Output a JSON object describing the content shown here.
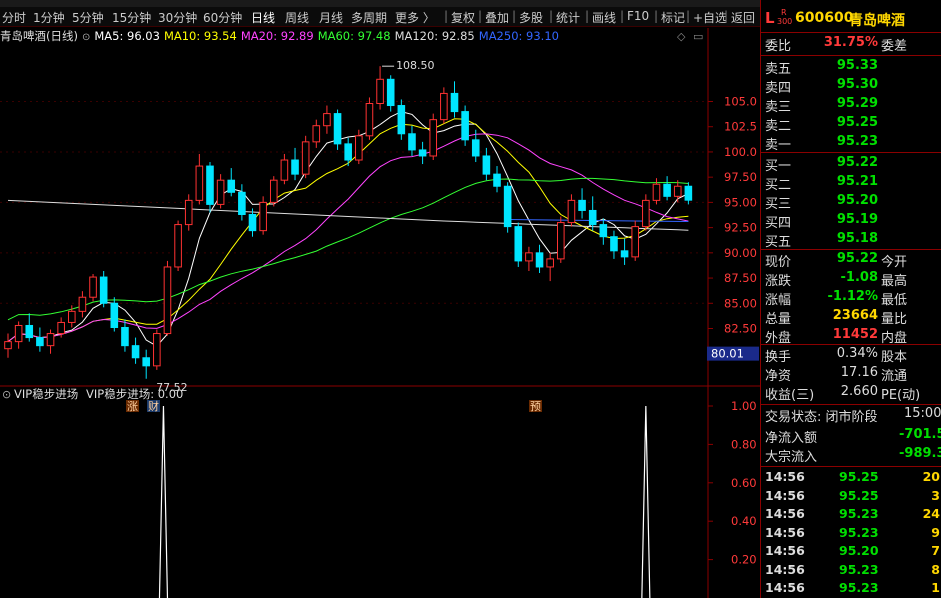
{
  "toolbar": {
    "periods": [
      "分时",
      "1分钟",
      "5分钟",
      "15分钟",
      "30分钟",
      "60分钟",
      "日线",
      "周线",
      "月线",
      "多周期",
      "更多 〉"
    ],
    "active_period": "日线",
    "actions": [
      "复权",
      "叠加",
      "多股",
      "统计",
      "画线",
      "F10",
      "标记",
      "+自选",
      "返回"
    ]
  },
  "chart": {
    "title": "青岛啤酒(日线)",
    "ma": [
      {
        "label": "MA5: 96.03",
        "color": "#ffffff"
      },
      {
        "label": "MA10: 93.54",
        "color": "#ffff00"
      },
      {
        "label": "MA20: 92.89",
        "color": "#ff44ff"
      },
      {
        "label": "MA60: 97.48",
        "color": "#33ff33"
      },
      {
        "label": "MA120: 92.85",
        "color": "#dddddd"
      },
      {
        "label": "MA250: 93.10",
        "color": "#3366ff"
      }
    ],
    "price_axis": [
      "105.0",
      "102.5",
      "100.0",
      "97.50",
      "95.00",
      "92.50",
      "90.00",
      "87.50",
      "85.00",
      "82.50",
      "80.00"
    ],
    "current_price_tag": "80.01",
    "high_label": "108.50",
    "low_label": "77.52",
    "markers": [
      "涨",
      "财",
      "预"
    ],
    "indicator_title": "VIP稳步进场",
    "indicator_label": "VIP稳步进场: 0.00",
    "indicator_axis": [
      "1.00",
      "0.80",
      "0.60",
      "0.40",
      "0.20"
    ],
    "colors": {
      "up": "#ff3232",
      "down": "#00e5ff"
    }
  },
  "chart_data": {
    "type": "candlestick",
    "title": "青岛啤酒(日线)",
    "ylim": [
      77.52,
      108.5
    ],
    "candles": [
      {
        "o": 80.5,
        "h": 82.0,
        "l": 79.6,
        "c": 81.2
      },
      {
        "o": 81.2,
        "h": 83.2,
        "l": 80.5,
        "c": 82.8
      },
      {
        "o": 82.8,
        "h": 84.0,
        "l": 81.2,
        "c": 81.6
      },
      {
        "o": 81.6,
        "h": 82.6,
        "l": 80.2,
        "c": 80.8
      },
      {
        "o": 80.8,
        "h": 82.4,
        "l": 80.0,
        "c": 82.0
      },
      {
        "o": 82.0,
        "h": 83.6,
        "l": 81.6,
        "c": 83.1
      },
      {
        "o": 83.1,
        "h": 84.8,
        "l": 82.6,
        "c": 84.2
      },
      {
        "o": 84.2,
        "h": 86.2,
        "l": 83.6,
        "c": 85.6
      },
      {
        "o": 85.6,
        "h": 87.9,
        "l": 85.2,
        "c": 87.6
      },
      {
        "o": 87.6,
        "h": 88.2,
        "l": 84.6,
        "c": 85.0
      },
      {
        "o": 85.0,
        "h": 85.6,
        "l": 82.2,
        "c": 82.6
      },
      {
        "o": 82.6,
        "h": 83.4,
        "l": 80.2,
        "c": 80.8
      },
      {
        "o": 80.8,
        "h": 81.6,
        "l": 79.0,
        "c": 79.6
      },
      {
        "o": 79.6,
        "h": 80.4,
        "l": 77.52,
        "c": 78.8
      },
      {
        "o": 78.8,
        "h": 82.4,
        "l": 78.4,
        "c": 82.0
      },
      {
        "o": 82.0,
        "h": 89.2,
        "l": 81.8,
        "c": 88.6
      },
      {
        "o": 88.6,
        "h": 93.2,
        "l": 88.2,
        "c": 92.8
      },
      {
        "o": 92.8,
        "h": 95.8,
        "l": 92.2,
        "c": 95.2
      },
      {
        "o": 95.2,
        "h": 99.8,
        "l": 94.8,
        "c": 98.6
      },
      {
        "o": 98.6,
        "h": 99.0,
        "l": 94.0,
        "c": 94.8
      },
      {
        "o": 94.8,
        "h": 97.8,
        "l": 94.4,
        "c": 97.2
      },
      {
        "o": 97.2,
        "h": 98.4,
        "l": 95.6,
        "c": 96.0
      },
      {
        "o": 96.0,
        "h": 96.8,
        "l": 93.2,
        "c": 93.8
      },
      {
        "o": 93.8,
        "h": 94.4,
        "l": 91.6,
        "c": 92.2
      },
      {
        "o": 92.2,
        "h": 95.6,
        "l": 91.8,
        "c": 95.0
      },
      {
        "o": 95.0,
        "h": 97.6,
        "l": 94.6,
        "c": 97.2
      },
      {
        "o": 97.2,
        "h": 99.8,
        "l": 96.8,
        "c": 99.2
      },
      {
        "o": 99.2,
        "h": 100.4,
        "l": 97.2,
        "c": 97.8
      },
      {
        "o": 97.8,
        "h": 101.6,
        "l": 97.4,
        "c": 101.0
      },
      {
        "o": 101.0,
        "h": 103.2,
        "l": 100.4,
        "c": 102.6
      },
      {
        "o": 102.6,
        "h": 104.6,
        "l": 101.8,
        "c": 103.8
      },
      {
        "o": 103.8,
        "h": 104.2,
        "l": 100.2,
        "c": 100.8
      },
      {
        "o": 100.8,
        "h": 101.4,
        "l": 98.6,
        "c": 99.2
      },
      {
        "o": 99.2,
        "h": 102.2,
        "l": 98.8,
        "c": 101.6
      },
      {
        "o": 101.6,
        "h": 105.4,
        "l": 101.2,
        "c": 104.8
      },
      {
        "o": 104.8,
        "h": 108.5,
        "l": 104.2,
        "c": 107.2
      },
      {
        "o": 107.2,
        "h": 107.6,
        "l": 104.0,
        "c": 104.6
      },
      {
        "o": 104.6,
        "h": 105.2,
        "l": 101.2,
        "c": 101.8
      },
      {
        "o": 101.8,
        "h": 102.6,
        "l": 99.6,
        "c": 100.2
      },
      {
        "o": 100.2,
        "h": 101.0,
        "l": 98.8,
        "c": 99.6
      },
      {
        "o": 99.6,
        "h": 103.8,
        "l": 99.2,
        "c": 103.2
      },
      {
        "o": 103.2,
        "h": 106.4,
        "l": 102.8,
        "c": 105.8
      },
      {
        "o": 105.8,
        "h": 107.0,
        "l": 103.4,
        "c": 104.0
      },
      {
        "o": 104.0,
        "h": 104.6,
        "l": 100.6,
        "c": 101.2
      },
      {
        "o": 101.2,
        "h": 102.2,
        "l": 99.0,
        "c": 99.6
      },
      {
        "o": 99.6,
        "h": 100.4,
        "l": 97.2,
        "c": 97.8
      },
      {
        "o": 97.8,
        "h": 98.6,
        "l": 96.0,
        "c": 96.6
      },
      {
        "o": 96.6,
        "h": 97.0,
        "l": 92.0,
        "c": 92.6
      },
      {
        "o": 92.6,
        "h": 93.0,
        "l": 88.6,
        "c": 89.2
      },
      {
        "o": 89.2,
        "h": 90.6,
        "l": 88.2,
        "c": 90.0
      },
      {
        "o": 90.0,
        "h": 90.8,
        "l": 88.0,
        "c": 88.6
      },
      {
        "o": 88.6,
        "h": 90.0,
        "l": 87.2,
        "c": 89.4
      },
      {
        "o": 89.4,
        "h": 93.6,
        "l": 89.0,
        "c": 93.0
      },
      {
        "o": 93.0,
        "h": 95.8,
        "l": 92.6,
        "c": 95.2
      },
      {
        "o": 95.2,
        "h": 96.4,
        "l": 93.4,
        "c": 94.2
      },
      {
        "o": 94.2,
        "h": 95.6,
        "l": 92.2,
        "c": 92.8
      },
      {
        "o": 92.8,
        "h": 93.4,
        "l": 90.8,
        "c": 91.6
      },
      {
        "o": 91.6,
        "h": 92.2,
        "l": 89.4,
        "c": 90.2
      },
      {
        "o": 90.2,
        "h": 91.4,
        "l": 88.8,
        "c": 89.6
      },
      {
        "o": 89.6,
        "h": 93.2,
        "l": 89.2,
        "c": 92.6
      },
      {
        "o": 92.6,
        "h": 95.8,
        "l": 92.2,
        "c": 95.2
      },
      {
        "o": 95.2,
        "h": 97.4,
        "l": 94.8,
        "c": 96.8
      },
      {
        "o": 96.8,
        "h": 97.6,
        "l": 95.2,
        "c": 95.6
      },
      {
        "o": 95.6,
        "h": 97.2,
        "l": 95.0,
        "c": 96.6
      },
      {
        "o": 96.6,
        "h": 97.0,
        "l": 94.8,
        "c": 95.22
      }
    ],
    "indicator": {
      "name": "VIP稳步进场",
      "signal_index": [
        15,
        60
      ],
      "value": 0.0
    }
  },
  "panel": {
    "code": "600600",
    "name": "青岛啤酒",
    "badge_l": "L",
    "badge_r": "R",
    "badge_300": "300",
    "webi": {
      "label": "委比",
      "value": "31.75%",
      "label2": "委差"
    },
    "sells": [
      {
        "label": "卖五",
        "price": "95.33"
      },
      {
        "label": "卖四",
        "price": "95.30"
      },
      {
        "label": "卖三",
        "price": "95.29"
      },
      {
        "label": "卖二",
        "price": "95.25"
      },
      {
        "label": "卖一",
        "price": "95.23"
      }
    ],
    "buys": [
      {
        "label": "买一",
        "price": "95.22"
      },
      {
        "label": "买二",
        "price": "95.21"
      },
      {
        "label": "买三",
        "price": "95.20"
      },
      {
        "label": "买四",
        "price": "95.19"
      },
      {
        "label": "买五",
        "price": "95.18"
      }
    ],
    "quote": [
      {
        "label": "现价",
        "value": "95.22",
        "label2": "今开",
        "color": "g"
      },
      {
        "label": "涨跌",
        "value": "-1.08",
        "label2": "最高",
        "color": "g"
      },
      {
        "label": "涨幅",
        "value": "-1.12%",
        "label2": "最低",
        "color": "g"
      },
      {
        "label": "总量",
        "value": "23664",
        "label2": "量比",
        "color": "y"
      },
      {
        "label": "外盘",
        "value": "11452",
        "label2": "内盘",
        "color": "r"
      }
    ],
    "stats": [
      {
        "label": "换手",
        "value": "0.34%",
        "label2": "股本"
      },
      {
        "label": "净资",
        "value": "17.16",
        "label2": "流通"
      },
      {
        "label": "收益(三)",
        "value": "2.660",
        "label2": "PE(动)"
      }
    ],
    "trade_status_label": "交易状态: 闭市阶段",
    "trade_status_time": "15:00",
    "net_inflow_label": "净流入额",
    "net_inflow_value": "-701.5",
    "block_inflow_label": "大宗流入",
    "block_inflow_value": "-989.3",
    "ticks": [
      {
        "t": "14:56",
        "p": "95.25",
        "v": "20"
      },
      {
        "t": "14:56",
        "p": "95.25",
        "v": "3"
      },
      {
        "t": "14:56",
        "p": "95.23",
        "v": "24"
      },
      {
        "t": "14:56",
        "p": "95.23",
        "v": "9"
      },
      {
        "t": "14:56",
        "p": "95.20",
        "v": "7"
      },
      {
        "t": "14:56",
        "p": "95.23",
        "v": "8"
      },
      {
        "t": "14:56",
        "p": "95.23",
        "v": "1"
      }
    ]
  }
}
